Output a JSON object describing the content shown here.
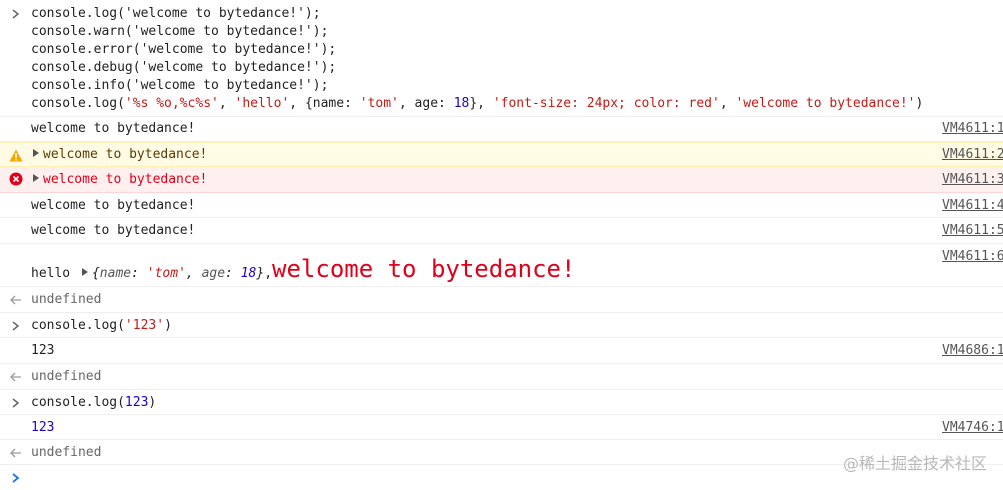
{
  "input1": {
    "lines": [
      "console.log('welcome to bytedance!');",
      "console.warn('welcome to bytedance!');",
      "console.error('welcome to bytedance!');",
      "console.debug('welcome to bytedance!');",
      "console.info('welcome to bytedance!');"
    ],
    "last_line": {
      "prefix": "console.log(",
      "fmt": "'%s %o,%c%s'",
      "sep1": ", ",
      "arg1": "'hello'",
      "sep2": ", {name: ",
      "name_val": "'tom'",
      "sep3": ", age: ",
      "age_val": "18",
      "sep4": "}, ",
      "style": "'font-size: 24px; color: red'",
      "sep5": ", ",
      "msg": "'welcome to bytedance!'",
      "suffix": ")"
    }
  },
  "outputs": {
    "log": {
      "text": "welcome to bytedance!",
      "source": "VM4611:1"
    },
    "warn": {
      "text": "welcome to bytedance!",
      "source": "VM4611:2"
    },
    "error": {
      "text": "welcome to bytedance!",
      "source": "VM4611:3"
    },
    "debug": {
      "text": "welcome to bytedance!",
      "source": "VM4611:4"
    },
    "info": {
      "text": "welcome to bytedance!",
      "source": "VM4611:5"
    },
    "formatted": {
      "hello": "hello",
      "obj_open": "{",
      "key_name": "name",
      "colon1": ": ",
      "val_name": "'tom'",
      "comma": ", ",
      "key_age": "age",
      "colon2": ": ",
      "val_age": "18",
      "obj_close": "}",
      "after_obj": ",",
      "styled": "welcome to bytedance!",
      "source": "VM4611:6"
    },
    "undefined1": "undefined"
  },
  "input2": {
    "code_prefix": "console.log(",
    "code_arg": "'123'",
    "code_suffix": ")",
    "output": "123",
    "source": "VM4686:1",
    "result": "undefined"
  },
  "input3": {
    "code_prefix": "console.log(",
    "code_arg": "123",
    "code_suffix": ")",
    "output": "123",
    "source": "VM4746:1",
    "result": "undefined"
  },
  "watermark": "@稀土掘金技术社区",
  "colors": {
    "string": "#c41a16",
    "number": "#1c00cf",
    "warn_bg": "#fffbe5",
    "error_bg": "#fff0f0",
    "error_text": "#e0001a",
    "prompt": "#1a73e8"
  },
  "icons": {
    "input_prompt": "chevron-right-icon",
    "result_return": "return-arrow-icon",
    "warning": "warning-icon",
    "error": "error-icon",
    "expand": "triangle-right-icon"
  }
}
